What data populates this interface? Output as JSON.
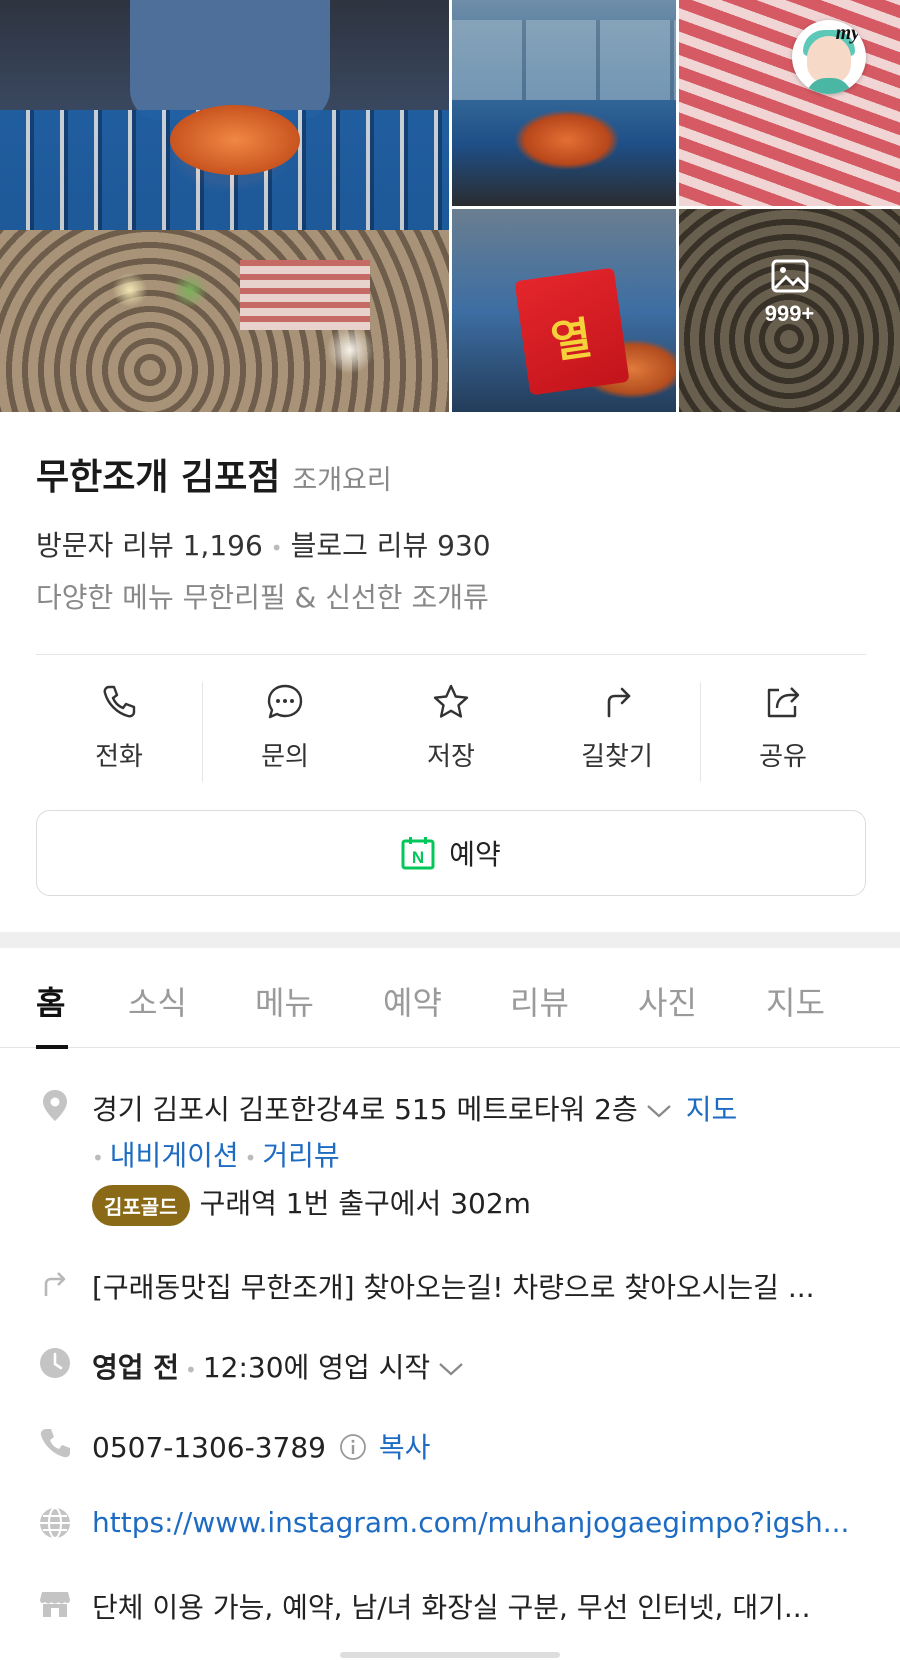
{
  "gallery": {
    "photo_count": "999+",
    "my_badge": "my",
    "noodle_pack_text": "열"
  },
  "header": {
    "name": "무한조개 김포점",
    "category": "조개요리",
    "visitor_review": "방문자 리뷰 1,196",
    "blog_review": "블로그 리뷰 930",
    "description": "다양한 메뉴 무한리필 & 신선한 조개류"
  },
  "actions": [
    {
      "label": "전화",
      "icon": "phone-icon"
    },
    {
      "label": "문의",
      "icon": "chat-icon"
    },
    {
      "label": "저장",
      "icon": "star-icon"
    },
    {
      "label": "길찾기",
      "icon": "directions-icon"
    },
    {
      "label": "공유",
      "icon": "share-icon"
    }
  ],
  "reserve_button": {
    "label": "예약",
    "icon": "naver-calendar-icon",
    "icon_letter": "N",
    "icon_color": "#03c75a"
  },
  "tabs": [
    {
      "label": "홈",
      "active": true
    },
    {
      "label": "소식"
    },
    {
      "label": "메뉴"
    },
    {
      "label": "예약"
    },
    {
      "label": "리뷰"
    },
    {
      "label": "사진"
    },
    {
      "label": "지도"
    }
  ],
  "info": {
    "address": "경기 김포시 김포한강4로 515 메트로타워 2층",
    "map_link": "지도",
    "navigation_link": "내비게이션",
    "street_view_link": "거리뷰",
    "zone_badge": "김포골드",
    "station_distance": "구래역 1번 출구에서 302m",
    "directions_text": "[구래동맛집 무한조개] 찾아오는길! 차량으로 찾아오시는길 ...",
    "hours_status": "영업 전",
    "hours_detail": "12:30에 영업 시작",
    "phone": "0507-1306-3789",
    "copy_label": "복사",
    "website": "https://www.instagram.com/muhanjogaegimpo?igsh...",
    "facilities": "단체 이용 가능, 예약, 남/녀 화장실 구분, 무선 인터넷, 대기..."
  },
  "colors": {
    "link": "#1e6bc2",
    "badge": "#8a6a17",
    "naver_green": "#03c75a"
  }
}
